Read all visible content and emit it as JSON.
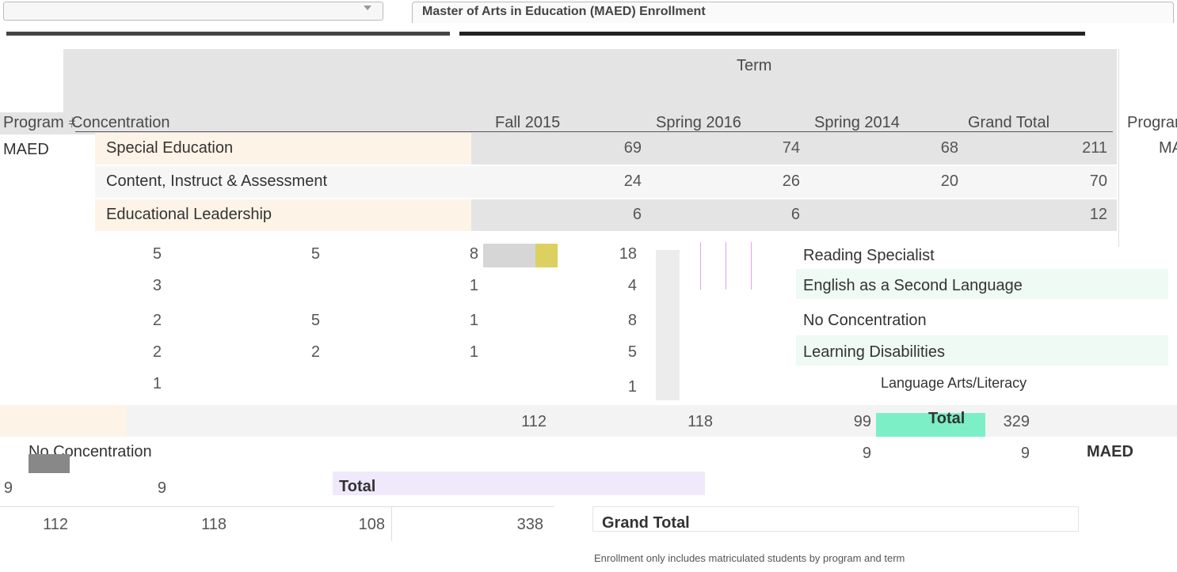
{
  "window": {
    "right_header_label": "Master of Arts in Education (MAED) Enrollment"
  },
  "table": {
    "term_header": "Term",
    "columns": {
      "program": "Program",
      "concentration": "Concentration",
      "fall_2015": "Fall 2015",
      "spring_2016": "Spring 2016",
      "spring_2014": "Spring 2014",
      "grand_total": "Grand Total"
    },
    "program_value": "MAED",
    "rows": [
      {
        "concentration": "Special Education",
        "fall": "69",
        "spring16": "74",
        "spring14": "68",
        "total": "211"
      },
      {
        "concentration": "Content, Instruct & Assessment",
        "fall": "24",
        "spring16": "26",
        "spring14": "20",
        "total": "70"
      },
      {
        "concentration": "Educational Leadership",
        "fall": "6",
        "spring16": "6",
        "spring14": "",
        "total": "12"
      },
      {
        "concentration": "Reading Specialist",
        "fall": "5",
        "spring16": "5",
        "spring14": "8",
        "total": "18"
      },
      {
        "concentration": "English as a Second Language",
        "fall": "3",
        "spring16": "",
        "spring14": "1",
        "total": "4"
      },
      {
        "concentration": "No Concentration",
        "fall": "2",
        "spring16": "5",
        "spring14": "1",
        "total": "8"
      },
      {
        "concentration": "Learning Disabilities",
        "fall": "2",
        "spring16": "2",
        "spring14": "1",
        "total": "5"
      },
      {
        "concentration": "Language Arts/Literacy",
        "fall": "1",
        "spring16": "",
        "spring14": "",
        "total": "1"
      }
    ],
    "total_row": {
      "label": "Total",
      "fall": "112",
      "spring16": "118",
      "spring14": "99",
      "total": "329"
    },
    "no_concentration_row": {
      "label": "No Concentration",
      "fall": "",
      "spring16": "9",
      "spring14": "",
      "total": "9"
    },
    "lower_total": {
      "label": "Total",
      "value": "9"
    },
    "grand_total_row": {
      "label": "Grand Total",
      "fall": "112",
      "spring16": "118",
      "spring14": "108",
      "total": "338"
    },
    "right_program_label": "MAED"
  },
  "footnote": "Enrollment only includes matriculated students by program and term"
}
